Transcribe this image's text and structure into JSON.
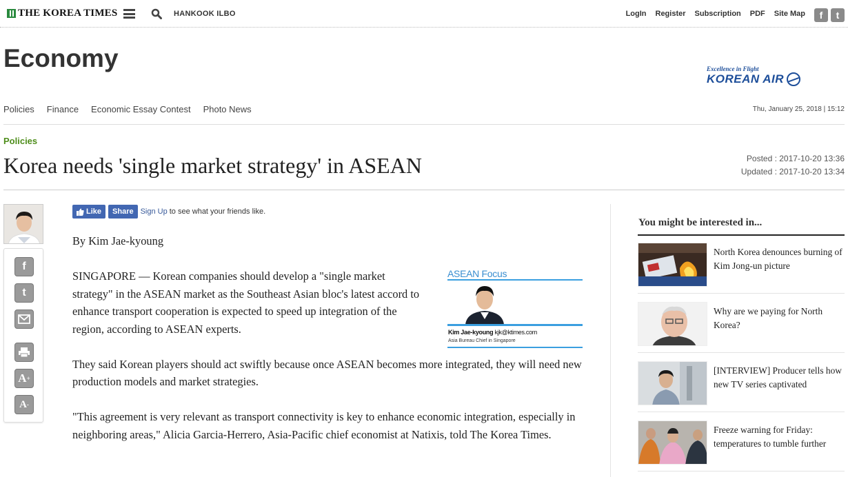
{
  "header": {
    "logo_text": "THE KOREA TIMES",
    "hankook": "HANKOOK ILBO",
    "links": [
      "LogIn",
      "Register",
      "Subscription",
      "PDF",
      "Site Map"
    ],
    "social": [
      "f",
      "t"
    ]
  },
  "section": {
    "title": "Economy",
    "ad": {
      "tagline": "Excellence in Flight",
      "brand": "KOREAN AIR"
    },
    "subnav": [
      "Policies",
      "Finance",
      "Economic Essay Contest",
      "Photo News"
    ],
    "datestamp": "Thu, January 25, 2018 | 15:12"
  },
  "article": {
    "category": "Policies",
    "headline": "Korea needs 'single market strategy' in ASEAN",
    "posted": "Posted : 2017-10-20 13:36",
    "updated": "Updated : 2017-10-20 13:34",
    "fb": {
      "like": "Like",
      "share": "Share",
      "signup": "Sign Up",
      "rest": "to see what your friends like."
    },
    "byline": "By Kim Jae-kyoung",
    "paragraphs": [
      "SINGAPORE — Korean companies should develop a \"single market strategy\" in the ASEAN market as the Southeast Asian bloc's latest accord to enhance transport cooperation is expected to speed up integration of the region, according to ASEAN experts.",
      "They said Korean players should act swiftly because once ASEAN becomes more integrated, they will need new production models and market strategies.",
      "\"This agreement is very relevant as transport connectivity is key to enhance economic integration, especially in neighboring areas,\" Alicia Garcia-Herrero, Asia-Pacific chief economist at Natixis, told The Korea Times."
    ],
    "asean_box": {
      "title": "ASEAN Focus",
      "name": "Kim Jae-kyoung",
      "email": "kjk@ktimes.com",
      "role": "Asia Bureau Chief in Singapore"
    }
  },
  "sidebar": {
    "title": "You might be interested in...",
    "items": [
      {
        "title": "North Korea denounces burning of Kim Jong-un picture"
      },
      {
        "title": "Why are we paying for North Korea?"
      },
      {
        "title": "[INTERVIEW] Producer tells how new TV series captivated"
      },
      {
        "title": "Freeze warning for Friday: temperatures to tumble further"
      }
    ]
  },
  "tools": [
    "facebook-icon",
    "twitter-icon",
    "email-icon",
    "print-icon",
    "font-increase-icon",
    "font-decrease-icon"
  ]
}
